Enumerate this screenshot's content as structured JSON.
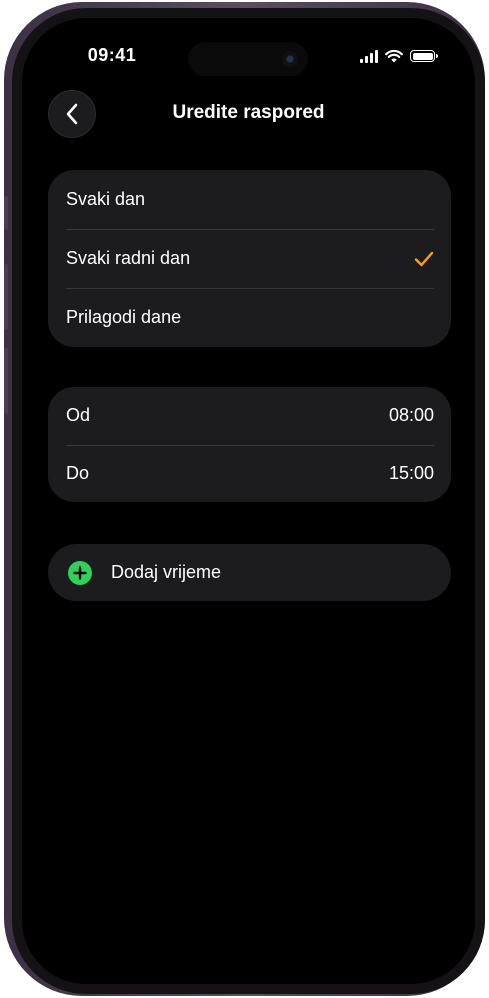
{
  "status_bar": {
    "time": "09:41"
  },
  "nav": {
    "title": "Uredite raspored",
    "back_icon": "chevron-left-icon"
  },
  "days_options": [
    {
      "label": "Svaki dan",
      "selected": false
    },
    {
      "label": "Svaki radni dan",
      "selected": true
    },
    {
      "label": "Prilagodi dane",
      "selected": false
    }
  ],
  "time_range": [
    {
      "label": "Od",
      "value": "08:00"
    },
    {
      "label": "Do",
      "value": "15:00"
    }
  ],
  "add_time": {
    "label": "Dodaj vrijeme",
    "icon": "plus-circle-icon"
  },
  "colors": {
    "accent": "#ff9f0a",
    "add_green": "#30d158",
    "cell_bg": "#1c1c1e",
    "screen_bg": "#000000"
  }
}
